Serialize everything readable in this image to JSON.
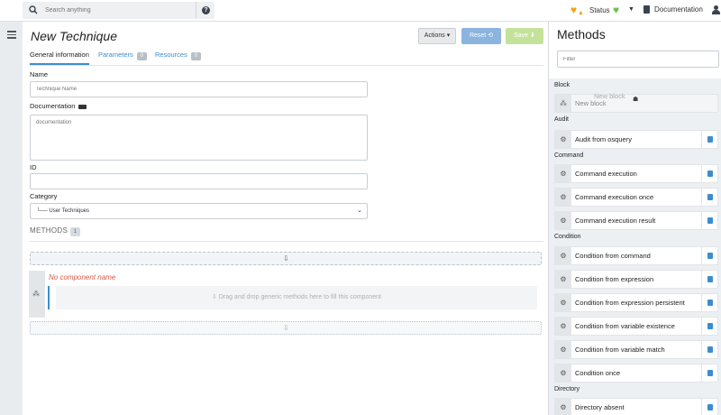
{
  "header": {
    "search_placeholder": "Search anything",
    "status_label": "Status",
    "documentation_label": "Documentation"
  },
  "editor": {
    "title": "New Technique",
    "actions_label": "Actions",
    "reset_label": "Reset",
    "save_label": "Save",
    "tabs": [
      {
        "label": "General information",
        "badge": ""
      },
      {
        "label": "Parameters",
        "badge": "0"
      },
      {
        "label": "Resources",
        "badge": "0"
      }
    ],
    "fields": {
      "name_label": "Name",
      "name_placeholder": "Technique Name",
      "documentation_label": "Documentation",
      "documentation_placeholder": "documentation",
      "id_label": "ID",
      "id_value": "",
      "category_label": "Category",
      "category_value": "└── User Techniques"
    },
    "methods_label": "METHODS",
    "methods_count": "1",
    "component": {
      "name": "No component name",
      "placeholder": "Drag and drop generic methods here to fill this component"
    }
  },
  "panel": {
    "title": "Methods",
    "filter_placeholder": "Filter",
    "dragging_item": "New block",
    "categories": [
      {
        "name": "Block",
        "items": [
          "New block"
        ]
      },
      {
        "name": "Audit",
        "items": [
          "Audit from osquery"
        ]
      },
      {
        "name": "Command",
        "items": [
          "Command execution",
          "Command execution once",
          "Command execution result"
        ]
      },
      {
        "name": "Condition",
        "items": [
          "Condition from command",
          "Condition from expression",
          "Condition from expression persistent",
          "Condition from variable existence",
          "Condition from variable match",
          "Condition once"
        ]
      },
      {
        "name": "Directory",
        "items": [
          "Directory absent"
        ]
      }
    ]
  },
  "colors": {
    "accent_blue": "#3c8dd0",
    "status_warning": "#f0a30a",
    "status_ok": "#6cc04a",
    "component_name_red": "#d45b4a"
  }
}
